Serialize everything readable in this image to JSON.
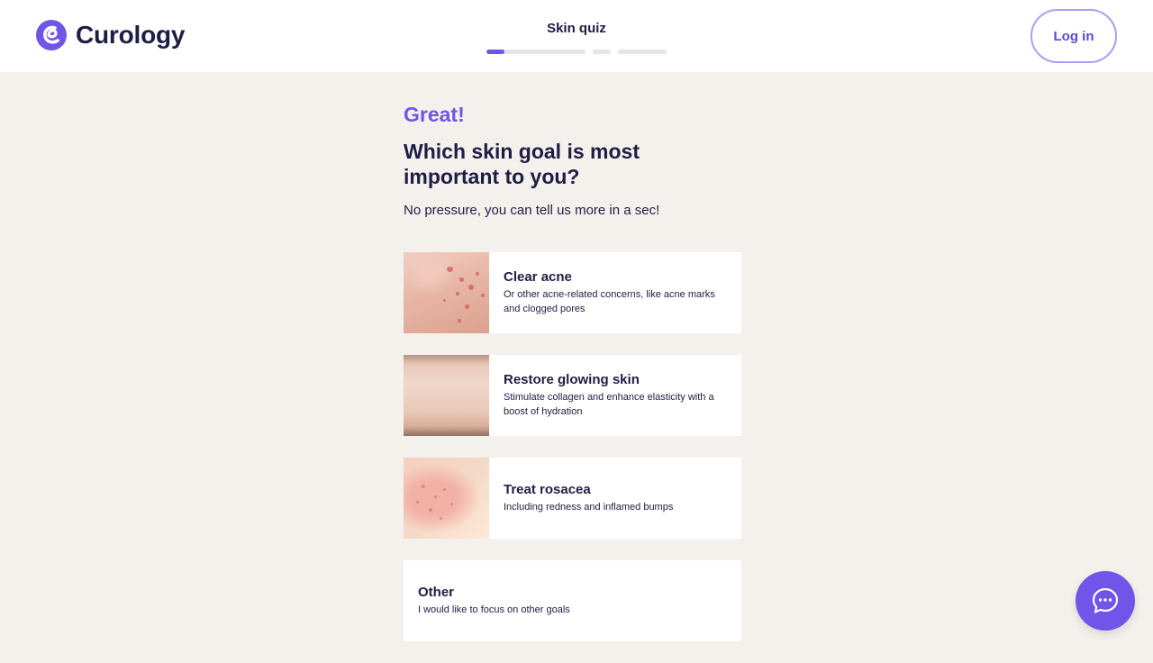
{
  "header": {
    "brand": "Curology",
    "quiz_title": "Skin quiz",
    "progress": [
      {
        "fraction": 0.18
      },
      {
        "fraction": 0
      },
      {
        "fraction": 0
      }
    ],
    "login_label": "Log in"
  },
  "main": {
    "eyebrow": "Great!",
    "question": "Which skin goal is most important to you?",
    "subtitle": "No pressure, you can tell us more in a sec!"
  },
  "options": [
    {
      "title": "Clear acne",
      "description": "Or other acne-related concerns, like acne marks and clogged pores"
    },
    {
      "title": "Restore glowing skin",
      "description": "Stimulate collagen and enhance elasticity with a boost of hydration"
    },
    {
      "title": "Treat rosacea",
      "description": "Including redness and inflamed bumps"
    },
    {
      "title": "Other",
      "description": "I would like to focus on other goals"
    }
  ],
  "colors": {
    "accent": "#6f55e8",
    "background": "#f4f1ec",
    "text": "#1e1d45"
  },
  "icons": {
    "logo": "curology-logo-icon",
    "chat": "chat-bubble-icon"
  }
}
